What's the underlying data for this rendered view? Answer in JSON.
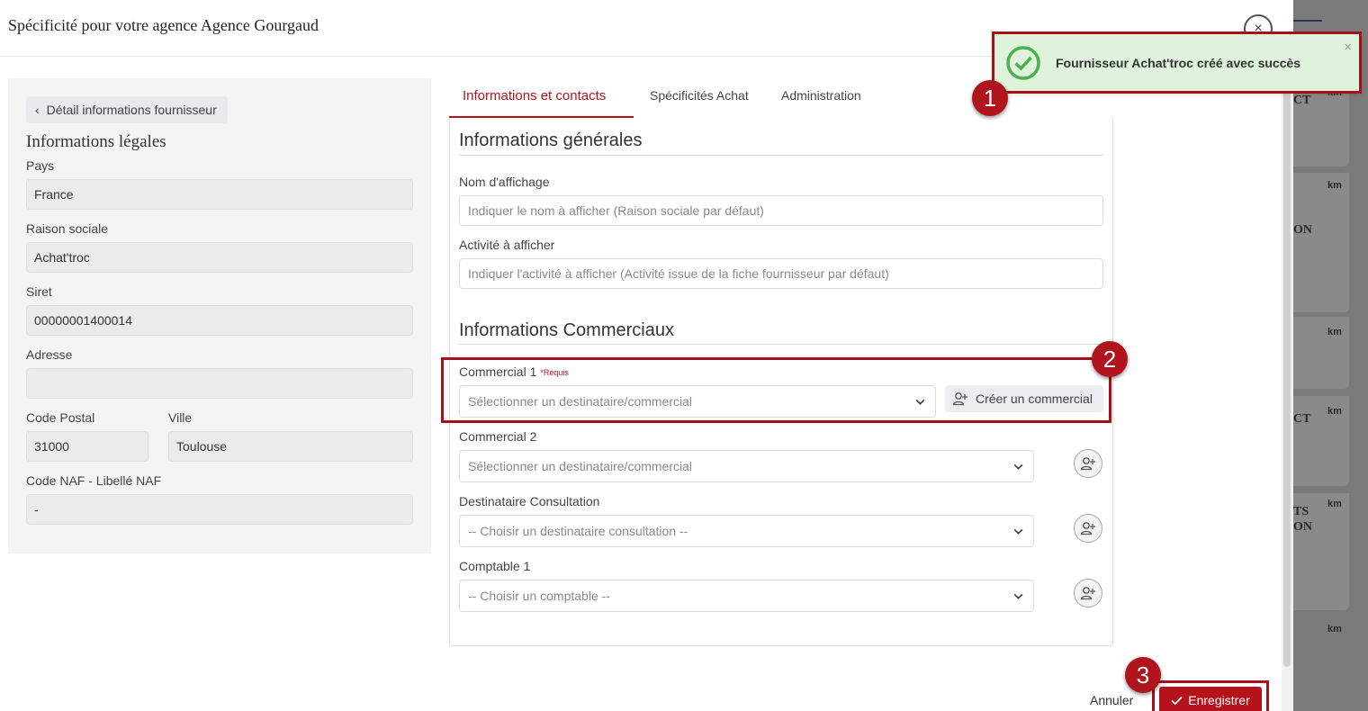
{
  "modal": {
    "title": "Spécificité pour votre agence Agence Gourgaud",
    "close_icon": "×"
  },
  "left": {
    "back_label": "Détail informations fournisseur",
    "section_title": "Informations légales",
    "fields": {
      "pays_label": "Pays",
      "pays_value": "France",
      "raison_label": "Raison sociale",
      "raison_value": "Achat'troc",
      "siret_label": "Siret",
      "siret_value": "00000001400014",
      "adresse_label": "Adresse",
      "adresse_value": "",
      "cp_label": "Code Postal",
      "cp_value": "31000",
      "ville_label": "Ville",
      "ville_value": "Toulouse",
      "naf_label": "Code NAF - Libellé NAF",
      "naf_value": "-"
    }
  },
  "tabs": [
    {
      "label": "Informations et contacts",
      "active": true
    },
    {
      "label": "Spécificités Achat",
      "active": false
    },
    {
      "label": "Administration",
      "active": false
    }
  ],
  "general": {
    "title": "Informations générales",
    "nom_label": "Nom d'affichage",
    "nom_placeholder": "Indiquer le nom à afficher (Raison sociale par défaut)",
    "activite_label": "Activité à afficher",
    "activite_placeholder": "Indiquer l'activité à afficher (Activité issue de la fiche fournisseur par défaut)"
  },
  "commercial": {
    "title": "Informations Commerciaux",
    "c1_label": "Commercial 1",
    "c1_required": "*Requis",
    "c1_placeholder": "Sélectionner un destinataire/commercial",
    "create_label": "Créer un commercial",
    "c2_label": "Commercial 2",
    "c2_placeholder": "Sélectionner un destinataire/commercial",
    "dest_label": "Destinataire Consultation",
    "dest_placeholder": "-- Choisir un destinataire consultation --",
    "comptable_label": "Comptable 1",
    "comptable_placeholder": "-- Choisir un comptable --"
  },
  "footer": {
    "cancel_label": "Annuler",
    "save_label": "Enregistrer"
  },
  "toast": {
    "message": "Fournisseur Achat'troc créé avec succès",
    "close": "×"
  },
  "annotations": {
    "badge1": "1",
    "badge2": "2",
    "badge3": "3",
    "highlight_color": "#a3121a"
  },
  "background": {
    "texts": [
      "CT",
      "ON",
      "CT",
      "TS",
      "ON"
    ],
    "km": [
      "km",
      "km",
      "km",
      "km",
      "km",
      "km"
    ]
  },
  "colors": {
    "accent": "#b5121b",
    "toast_bg": "#dff2dc",
    "success": "#4caf50"
  }
}
